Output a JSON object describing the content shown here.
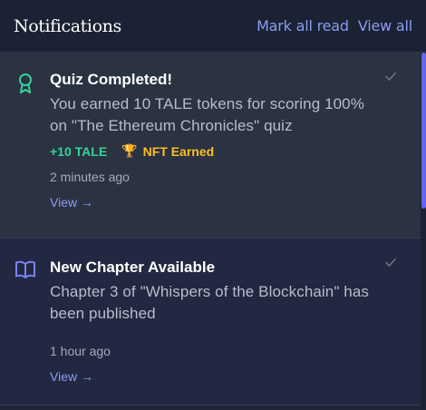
{
  "header": {
    "title": "Notifications",
    "mark_all_label": "Mark all read",
    "view_all_label": "View all"
  },
  "notifications": [
    {
      "icon": "award-ribbon-icon",
      "title": "Quiz Completed!",
      "body": "You earned 10 TALE tokens for scoring 100% on \"The Ethereum Chronicles\" quiz",
      "token_badge": "+10 TALE",
      "nft_badge": "NFT Earned",
      "time": "2 minutes ago",
      "link": "View →",
      "unread": true
    },
    {
      "icon": "open-book-icon",
      "title": "New Chapter Available",
      "body": "Chapter 3 of \"Whispers of the Blockchain\" has been published",
      "time": "1 hour ago",
      "link": "View →",
      "unread": false
    }
  ],
  "colors": {
    "accent": "#8b9cf2",
    "success": "#34d399",
    "warning": "#fbbf24",
    "scroll_thumb": "#6366f1"
  }
}
